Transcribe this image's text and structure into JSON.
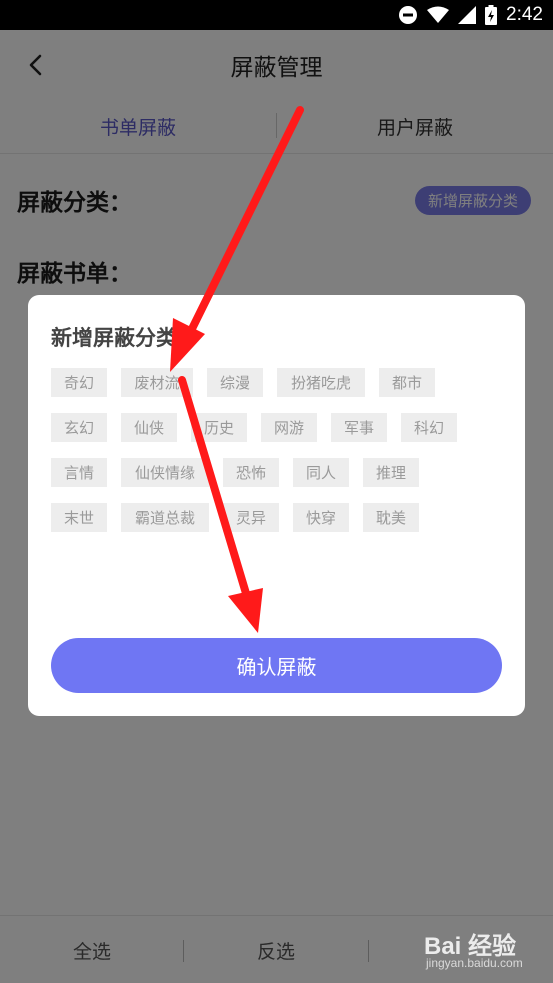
{
  "status_bar": {
    "time": "2:42"
  },
  "header": {
    "title": "屏蔽管理"
  },
  "tabs": [
    {
      "label": "书单屏蔽",
      "active": true
    },
    {
      "label": "用户屏蔽",
      "active": false
    }
  ],
  "sections": {
    "category_label": "屏蔽分类：",
    "add_category_button": "新增屏蔽分类",
    "booklist_label": "屏蔽书单："
  },
  "dialog": {
    "title": "新增屏蔽分类",
    "tag_rows": [
      [
        "奇幻",
        "废材流",
        "综漫",
        "扮猪吃虎",
        "都市"
      ],
      [
        "玄幻",
        "仙侠",
        "历史",
        "网游",
        "军事",
        "科幻"
      ],
      [
        "言情",
        "仙侠情缘",
        "恐怖",
        "同人",
        "推理"
      ],
      [
        "末世",
        "霸道总裁",
        "灵异",
        "快穿",
        "耽美"
      ]
    ],
    "confirm_button": "确认屏蔽"
  },
  "bottom_bar": {
    "select_all": "全选",
    "invert_selection": "反选"
  },
  "watermark": {
    "logo": "Bai  经验",
    "sub": "jingyan.baidu.com"
  },
  "colors": {
    "accent": "#5b59c9",
    "add_button": "#7b7ce8",
    "confirm_button": "#6f76f3",
    "arrow": "#ff1a1a"
  }
}
